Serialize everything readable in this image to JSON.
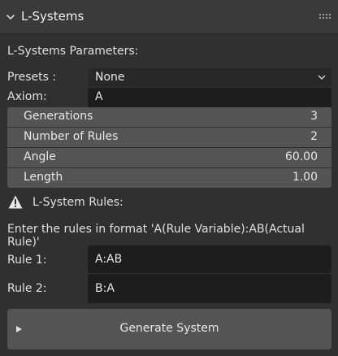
{
  "panel": {
    "title": "L-Systems"
  },
  "parameters": {
    "heading": "L-Systems Parameters:",
    "presets_label": "Presets :",
    "presets_value": "None",
    "axiom_label": "Axiom:",
    "axiom_value": "A",
    "fields": [
      {
        "label": "Generations",
        "value": "3"
      },
      {
        "label": "Number of Rules",
        "value": "2"
      },
      {
        "label": "Angle",
        "value": "60.00"
      },
      {
        "label": "Length",
        "value": "1.00"
      }
    ]
  },
  "rules": {
    "heading": "L-System Rules:",
    "instructions": "Enter the rules in format 'A(Rule Variable):AB(Actual Rule)'",
    "items": [
      {
        "label": "Rule 1:",
        "value": "A:AB"
      },
      {
        "label": "Rule 2:",
        "value": "B:A"
      }
    ]
  },
  "generate_button": {
    "label": "Generate System"
  },
  "icons": {
    "collapse": "chevron-down-icon",
    "drag": "drag-grip-icon",
    "dropdown": "dropdown-arrow-icon",
    "warning": "warning-icon",
    "play": "play-icon"
  },
  "colors": {
    "panel_bg": "#303030",
    "header_bg": "#3a3a3a",
    "field_bg": "#1d1d1d",
    "numrow_bg": "#545454",
    "button_bg": "#545454",
    "text": "#e6e6e6"
  }
}
